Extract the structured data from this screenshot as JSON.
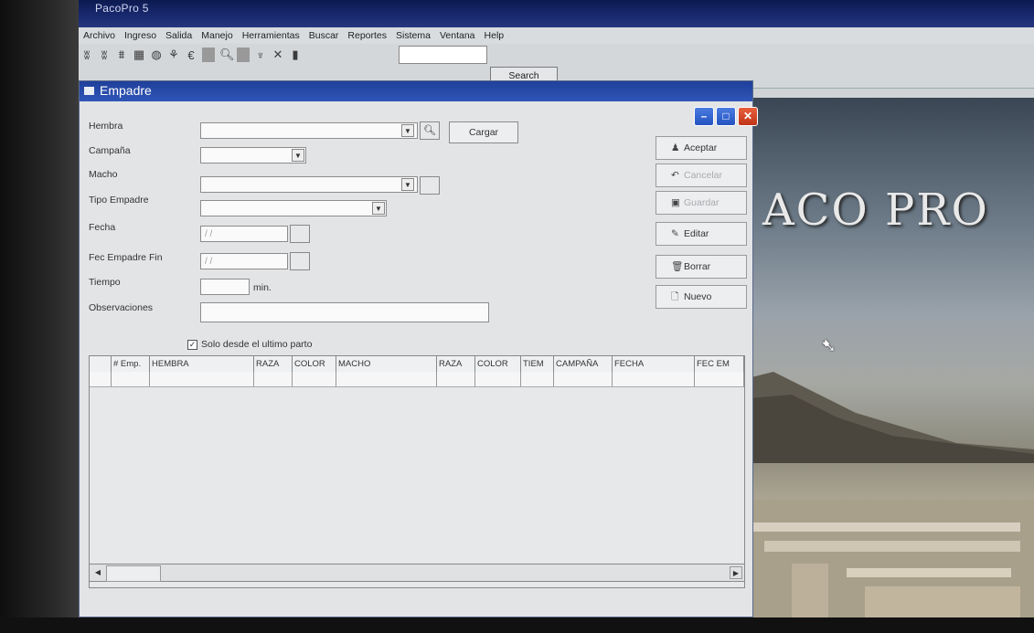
{
  "app": {
    "title": "PacoPro 5"
  },
  "menu": [
    "Archivo",
    "Ingreso",
    "Salida",
    "Manejo",
    "Herramientas",
    "Buscar",
    "Reportes",
    "Sistema",
    "Ventana",
    "Help"
  ],
  "toolbar": {
    "icons": [
      "tool-1-icon",
      "tool-2-icon",
      "tool-3-icon",
      "grid-icon",
      "globe-icon",
      "tool-6-icon",
      "currency-icon",
      "search-icon",
      "tool-9-icon",
      "close-x-icon",
      "bar-icon"
    ],
    "search_value": "",
    "search_button": "Search"
  },
  "desktop": {
    "brand_text": "ACO PRO"
  },
  "window": {
    "title": "Empadre",
    "labels": {
      "hembra": "Hembra",
      "campana": "Campaña",
      "macho": "Macho",
      "tipo": "Tipo Empadre",
      "fecha": "Fecha",
      "fec_fin": "Fec Empadre Fin",
      "tiempo": "Tiempo",
      "obs": "Observaciones"
    },
    "fecha_value": "/ /",
    "fec_fin_value": "/ /",
    "tiempo_unit": "min.",
    "cargar": "Cargar",
    "checkbox_label": "Solo desde el ultimo parto",
    "checkbox_checked": true,
    "buttons": {
      "aceptar": "Aceptar",
      "cancelar": "Cancelar",
      "guardar": "Guardar",
      "editar": "Editar",
      "borrar": "Borrar",
      "nuevo": "Nuevo"
    },
    "grid_columns": [
      "# Emp.",
      "HEMBRA",
      "RAZA",
      "COLOR",
      "MACHO",
      "RAZA",
      "COLOR",
      "TIEM",
      "CAMPAÑA",
      "FECHA",
      "FEC EM"
    ]
  }
}
